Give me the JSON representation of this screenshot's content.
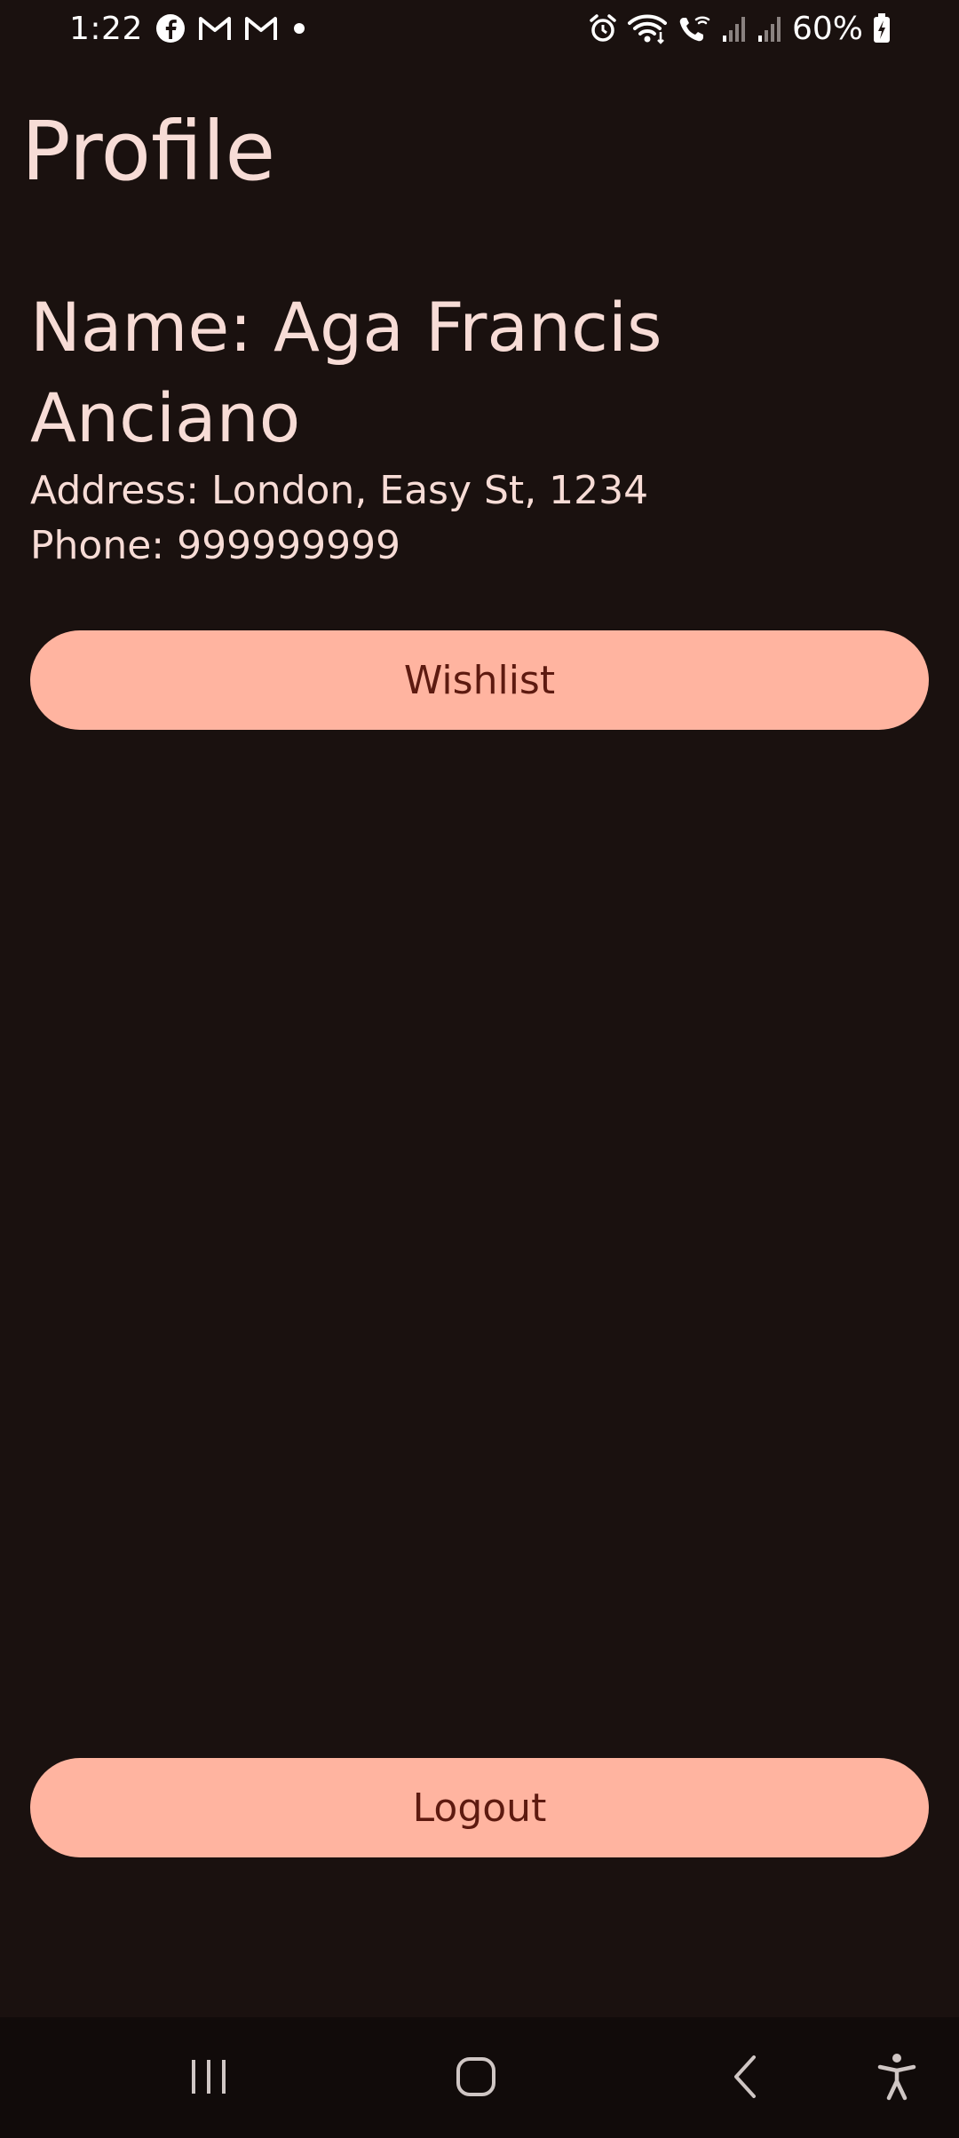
{
  "status_bar": {
    "time": "1:22",
    "battery_percent": "60%",
    "notification_icons": [
      "facebook-icon",
      "gmail-icon",
      "gmail-icon",
      "dot-icon"
    ],
    "system_icons": [
      "alarm-icon",
      "wifi-icon",
      "wifi-calling-icon",
      "signal-icon",
      "signal-icon",
      "battery-charging-icon"
    ]
  },
  "page": {
    "title": "Profile"
  },
  "profile": {
    "name_line1": "Name: Aga Francis",
    "name_line2": "Anciano",
    "address": "Address: London, Easy St, 1234",
    "phone": "Phone: 999999999"
  },
  "actions": {
    "wishlist_label": "Wishlist",
    "logout_label": "Logout"
  },
  "colors": {
    "background": "#1a110f",
    "text": "#f7dcd6",
    "button_background": "#ffb4a0",
    "button_text": "#5d1a10",
    "nav_background": "#110b0a"
  },
  "nav_bar": {
    "buttons": [
      "recents-icon",
      "home-icon",
      "back-icon",
      "accessibility-icon"
    ]
  }
}
